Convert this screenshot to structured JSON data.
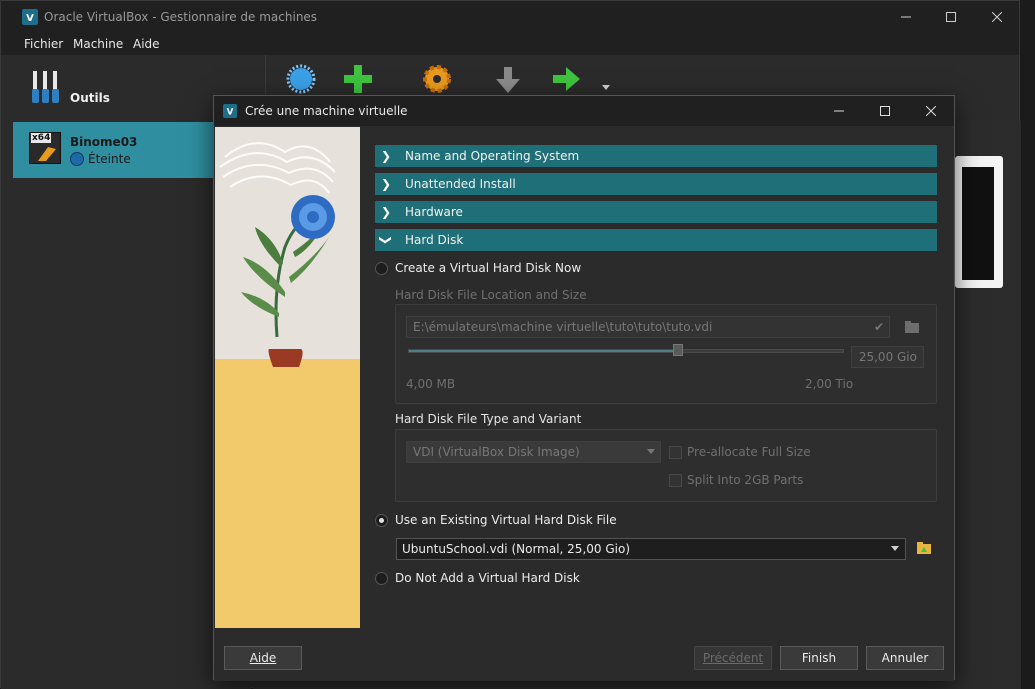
{
  "app": {
    "title": "Oracle VirtualBox - Gestionnaire de machines",
    "menu": [
      "Fichier",
      "Machine",
      "Aide"
    ]
  },
  "sidebar": {
    "tools_label": "Outils",
    "vm": {
      "name": "Binome03",
      "state": "Éteinte",
      "badge": "x64"
    }
  },
  "toolbar": {
    "icons": [
      "new-icon",
      "add-icon",
      "settings-icon",
      "discard-icon",
      "start-icon",
      "dropdown-arrow-icon"
    ]
  },
  "dialog": {
    "title": "Crée une machine virtuelle",
    "sections": [
      {
        "label": "Name and Operating System",
        "expanded": false
      },
      {
        "label": "Unattended Install",
        "expanded": false
      },
      {
        "label": "Hardware",
        "expanded": false
      },
      {
        "label": "Hard Disk",
        "expanded": true
      }
    ],
    "hard_disk": {
      "opt_create": "Create a Virtual Hard Disk Now",
      "location_group": "Hard Disk File Location and Size",
      "location_value": "E:\\émulateurs\\machine virtuelle\\tuto\\tuto\\tuto.vdi",
      "size_value": "25,00 Gio",
      "size_min": "4,00 MB",
      "size_max": "2,00 Tio",
      "size_fraction": 0.62,
      "type_group": "Hard Disk File Type and Variant",
      "type_value": "VDI (VirtualBox Disk Image)",
      "prealloc_label": "Pre-allocate Full Size",
      "split_label": "Split Into 2GB Parts",
      "opt_existing": "Use an Existing Virtual Hard Disk File",
      "existing_value": "UbuntuSchool.vdi (Normal, 25,00 Gio)",
      "opt_none": "Do Not Add a Virtual Hard Disk",
      "selected_option": "existing"
    },
    "buttons": {
      "help": "Aide",
      "back": "Précédent",
      "finish": "Finish",
      "cancel": "Annuler"
    }
  },
  "colors": {
    "accent": "#1f6f78",
    "selection": "#2f8fa0",
    "background": "#2b2b2b"
  }
}
